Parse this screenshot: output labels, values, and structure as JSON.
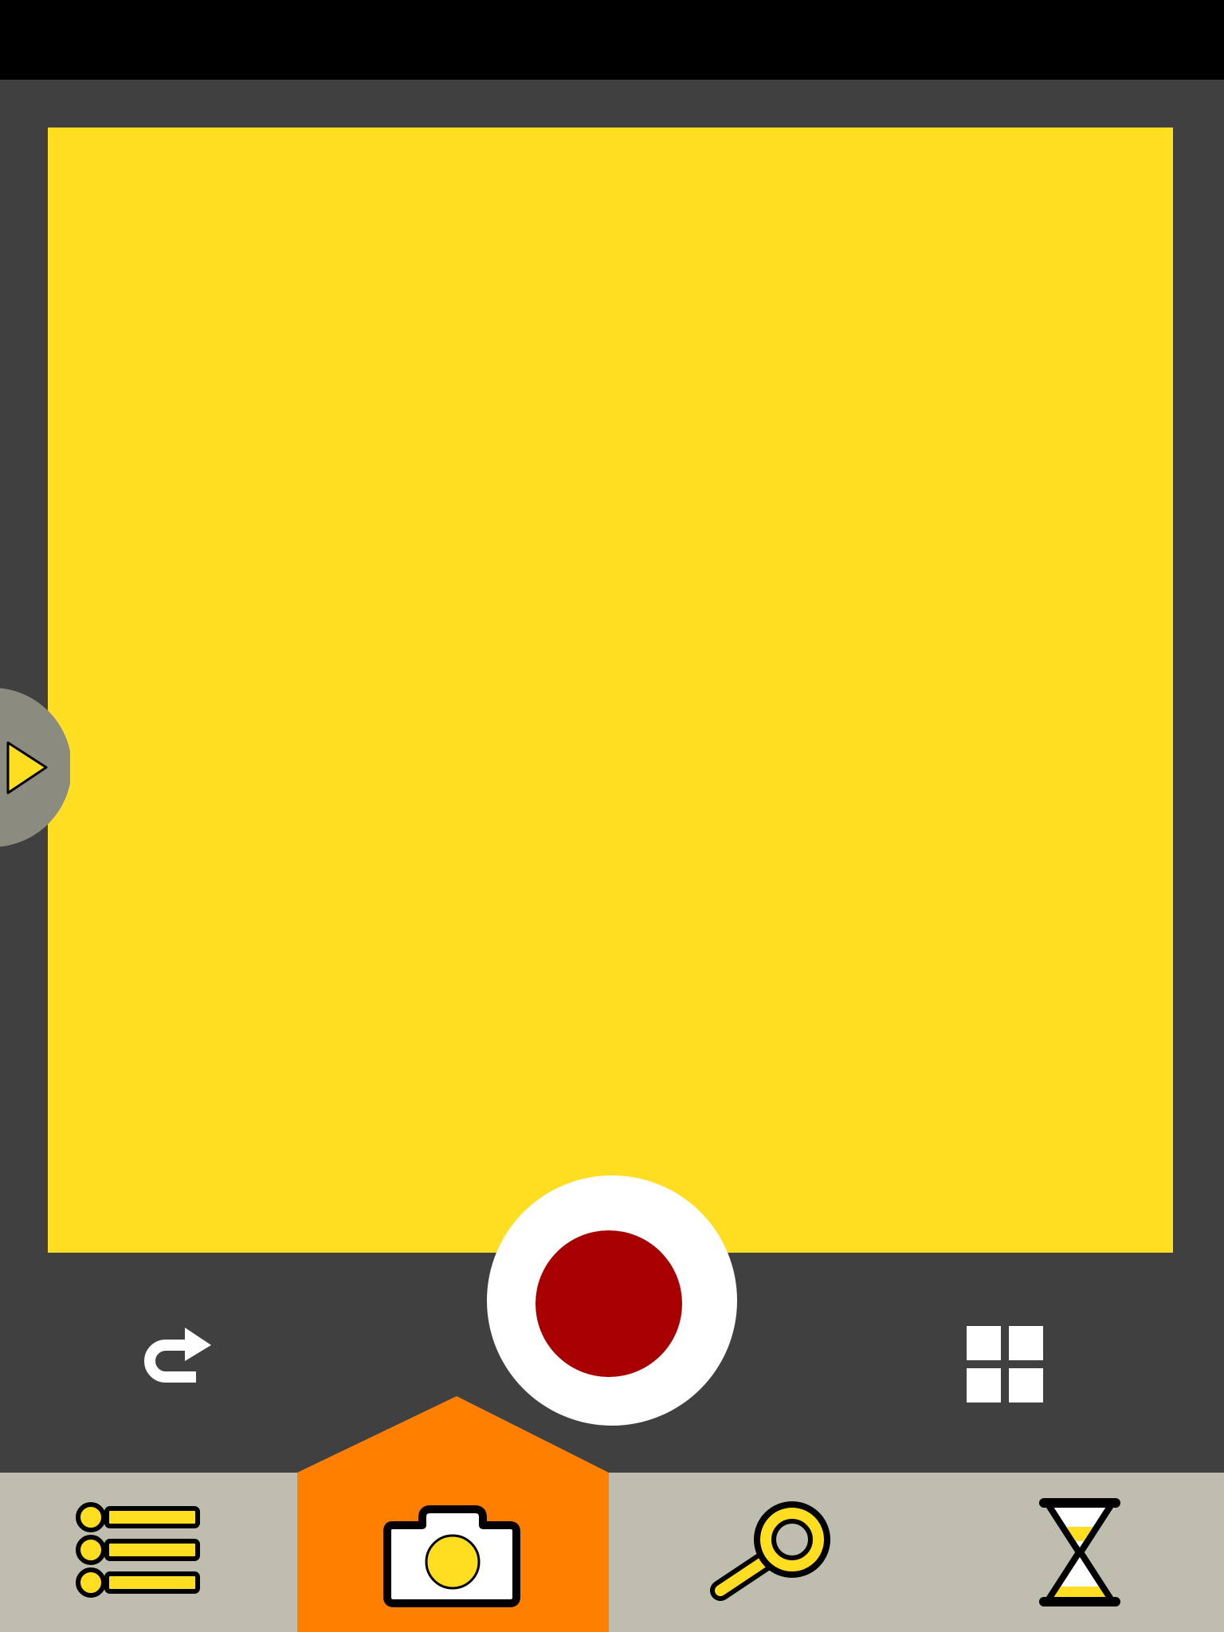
{
  "app": {
    "screen": "camera-capture",
    "colors": {
      "status_bar": "#000000",
      "background": "#404040",
      "viewfinder": "#ffde21",
      "shutter_ring": "#ffffff",
      "shutter_record": "#a80000",
      "nav_bar": "#bebdae",
      "active_tab": "#ff8000",
      "icon_fill": "#ffde21",
      "icon_stroke": "#000000",
      "side_handle": "#8c8b80"
    }
  },
  "viewfinder": {
    "state": "live-preview"
  },
  "side_panel": {
    "icon": "play-triangle-icon"
  },
  "controls": {
    "left": {
      "icon": "return-arrow-icon"
    },
    "center": {
      "icon": "record-shutter-icon"
    },
    "right": {
      "icon": "grid-icon"
    }
  },
  "bottom_nav": {
    "active_index": 1,
    "tabs": [
      {
        "icon": "list-icon"
      },
      {
        "icon": "camera-icon"
      },
      {
        "icon": "magnifier-icon"
      },
      {
        "icon": "hourglass-icon"
      }
    ]
  }
}
